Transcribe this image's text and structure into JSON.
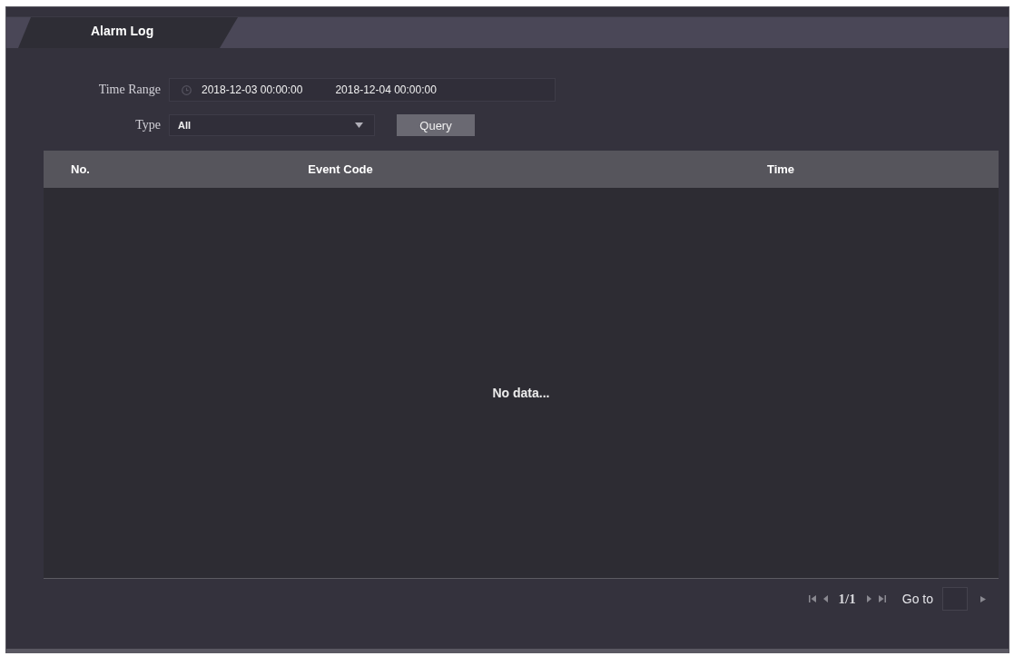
{
  "tabs": [
    {
      "label": "Alarm Log",
      "selected": true
    }
  ],
  "filters": {
    "time_range": {
      "label": "Time Range",
      "start": "2018-12-03 00:00:00",
      "end": "2018-12-04 00:00:00"
    },
    "type": {
      "label": "Type",
      "value": "All"
    },
    "query_button": "Query"
  },
  "table": {
    "columns": [
      "No.",
      "Event Code",
      "Time"
    ],
    "empty_message": "No data..."
  },
  "pagination": {
    "page": "1/1",
    "goto_label": "Go to"
  }
}
